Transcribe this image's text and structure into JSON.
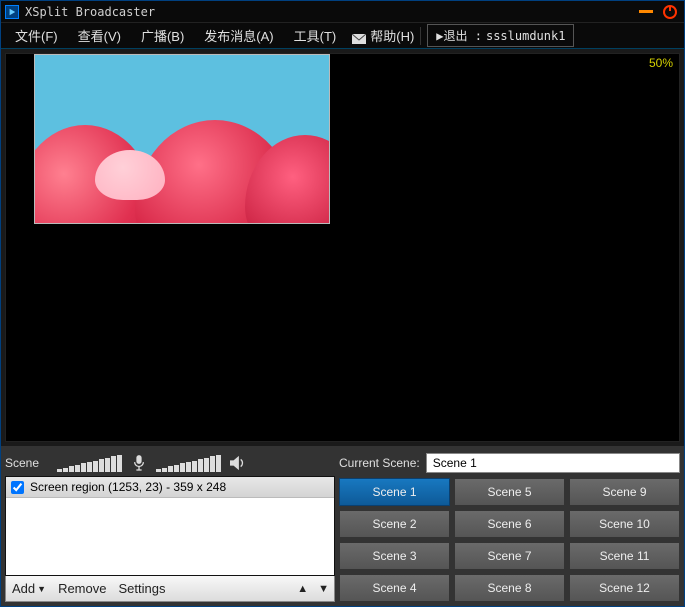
{
  "title": "XSplit Broadcaster",
  "menu": {
    "file": "文件(F)",
    "view": "查看(V)",
    "broadcast": "广播(B)",
    "publish": "发布消息(A)",
    "tools": "工具(T)",
    "help": "帮助(H)"
  },
  "logout": {
    "prefix": "▶退出 : ",
    "user": "ssslumdunk1"
  },
  "zoom": "50%",
  "scene_label": "Scene",
  "current_scene_label": "Current Scene:",
  "current_scene_value": "Scene 1",
  "sources": [
    {
      "checked": true,
      "label": "Screen region (1253, 23) - 359 x 248"
    }
  ],
  "toolbar": {
    "add": "Add",
    "remove": "Remove",
    "settings": "Settings"
  },
  "scenes": [
    "Scene 1",
    "Scene 2",
    "Scene 3",
    "Scene 4",
    "Scene 5",
    "Scene 6",
    "Scene 7",
    "Scene 8",
    "Scene 9",
    "Scene 10",
    "Scene 11",
    "Scene 12"
  ],
  "active_scene_index": 0
}
